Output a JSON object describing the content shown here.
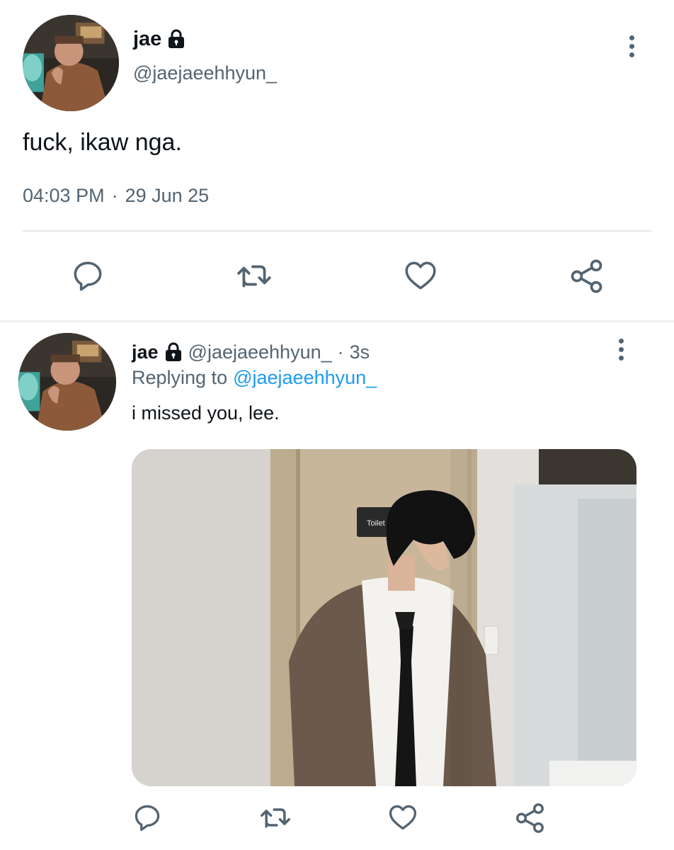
{
  "colors": {
    "text": "#0f1419",
    "secondary": "#536471",
    "link": "#1d9bf0",
    "divider": "#e4e7ea"
  },
  "main_tweet": {
    "display_name": "jae",
    "handle": "@jaejaeehhyun_",
    "text": "fuck, ikaw nga.",
    "time": "04:03 PM",
    "separator": "·",
    "date": "29 Jun 25",
    "icons": [
      "lock-icon",
      "more-icon",
      "reply-icon",
      "retweet-icon",
      "like-icon",
      "share-icon"
    ]
  },
  "reply_tweet": {
    "display_name": "jae",
    "handle": "@jaejaeehhyun_",
    "separator": "·",
    "age": "3s",
    "replying_prefix": "Replying to",
    "replying_handle": "@jaejaeehhyun_",
    "text": "i missed you, lee.",
    "photo_sign": "Toilet",
    "icons": [
      "lock-icon",
      "more-icon",
      "reply-icon",
      "retweet-icon",
      "like-icon",
      "share-icon"
    ]
  }
}
